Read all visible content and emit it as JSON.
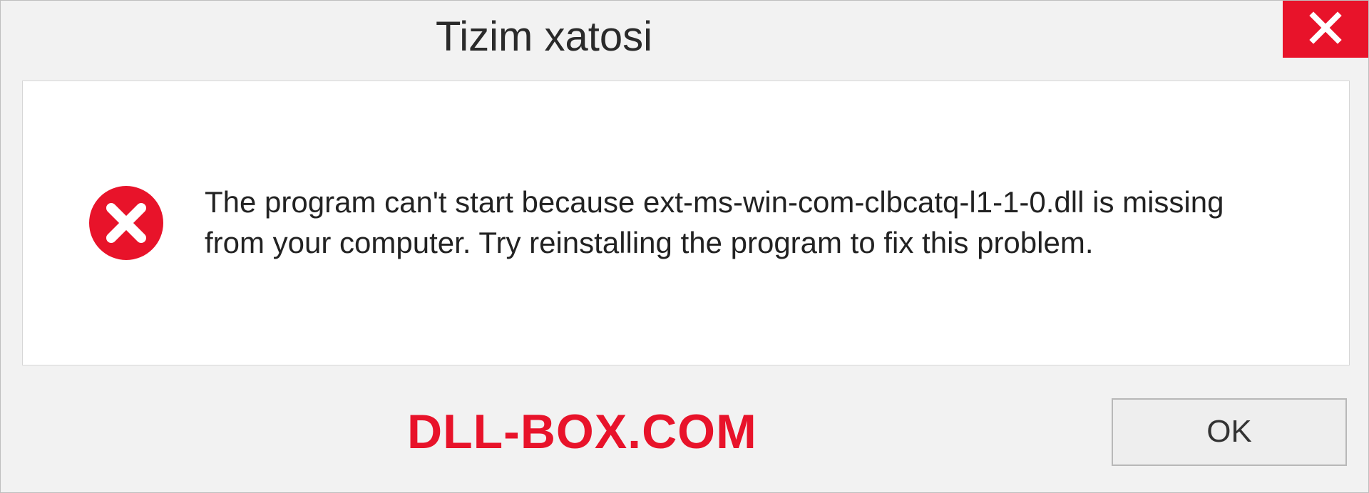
{
  "dialog": {
    "title": "Tizim xatosi",
    "message": "The program can't start because ext-ms-win-com-clbcatq-l1-1-0.dll is missing from your computer. Try reinstalling the program to fix this problem.",
    "ok_label": "OK"
  },
  "watermark": "DLL-BOX.COM"
}
